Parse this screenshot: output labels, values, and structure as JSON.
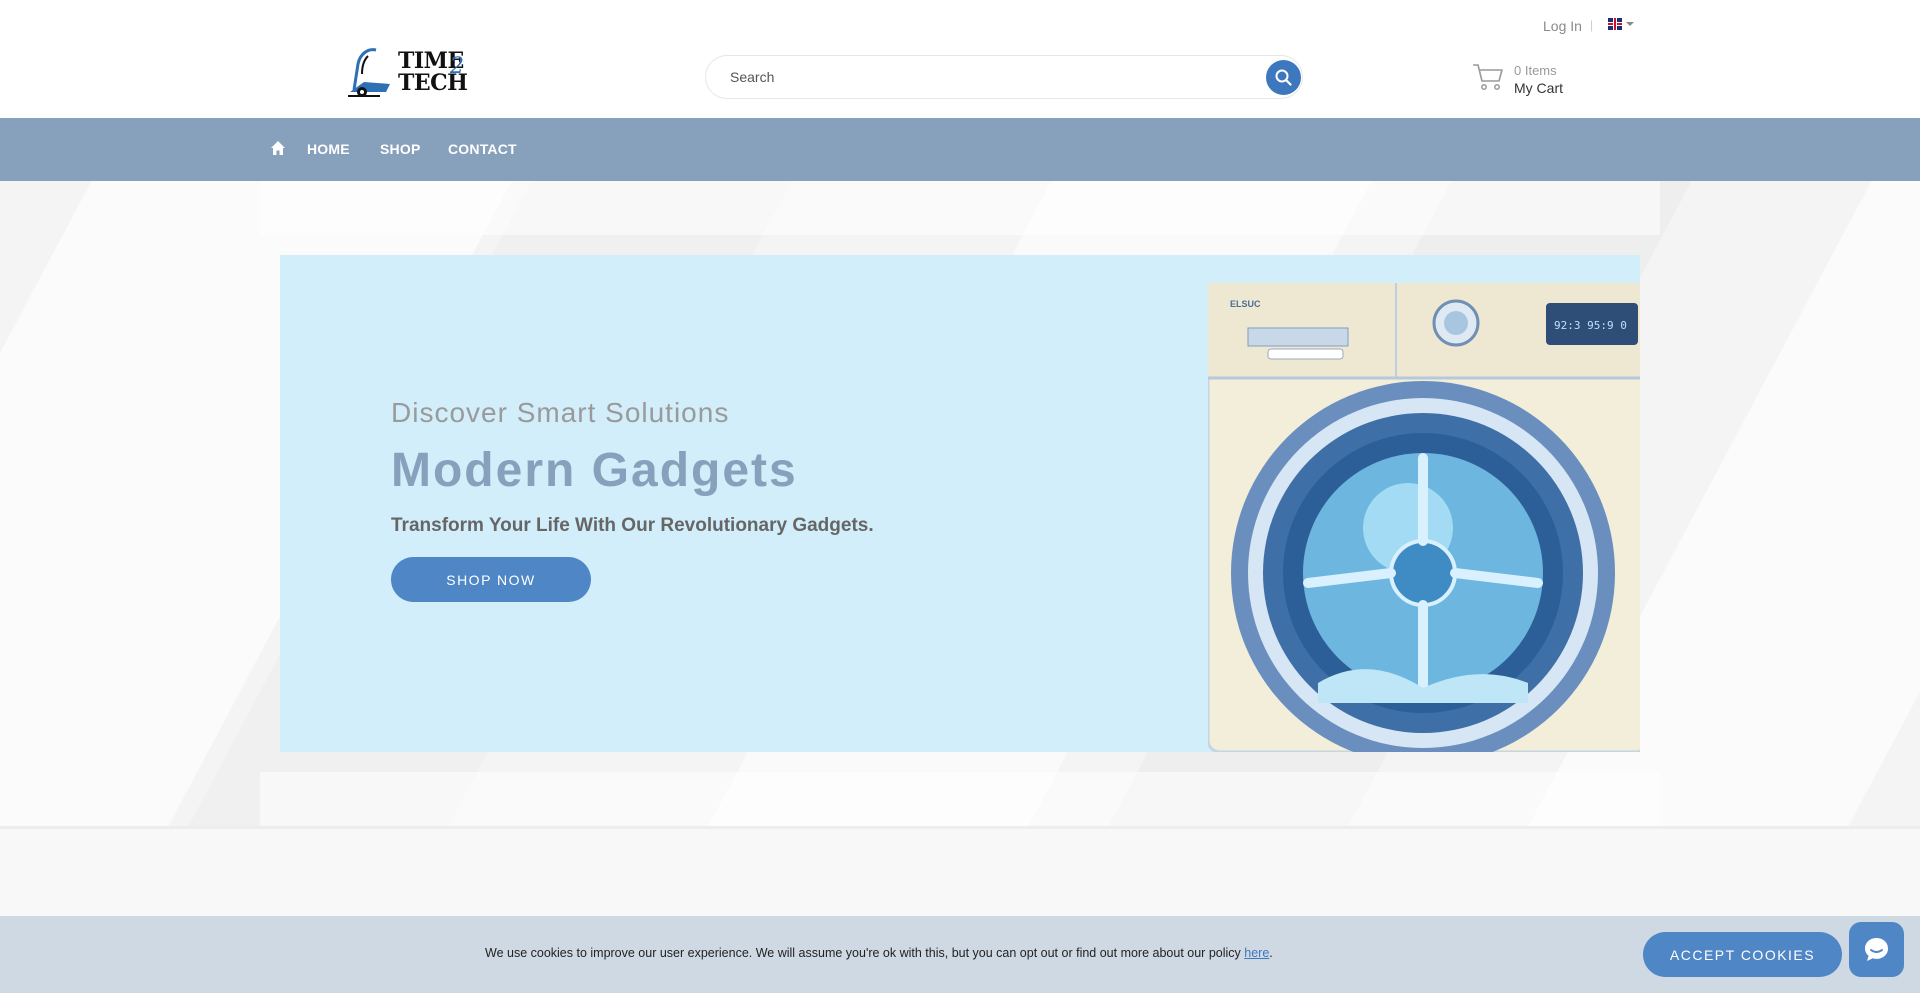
{
  "header": {
    "login_label": "Log In",
    "language": "English (UK)",
    "logo_line1": "TIME",
    "logo_line2": "TECH",
    "logo_mark": "2",
    "search_placeholder": "Search",
    "cart_count": "0 Items",
    "cart_label": "My Cart"
  },
  "nav": {
    "items": [
      "HOME",
      "SHOP",
      "CONTACT"
    ]
  },
  "hero": {
    "kicker": "Discover Smart Solutions",
    "title": "Modern Gadgets",
    "subtitle": "Transform Your Life With Our Revolutionary Gadgets.",
    "cta": "SHOP NOW",
    "image_label": "ELSUC",
    "display_readout": "92:3 95:9 0"
  },
  "cookie": {
    "text": "We use cookies to improve our user experience. We will assume you're ok with this, but you can opt out or find out more about our policy ",
    "link": "here",
    "end": ".",
    "accept": "ACCEPT COOKIES"
  },
  "icons": {
    "home": "home-icon",
    "search": "search-icon",
    "cart": "cart-icon",
    "chat": "chat-icon",
    "flag": "uk-flag-icon"
  },
  "colors": {
    "nav_bg": "#87a0bb",
    "accent": "#4e86c6",
    "hero_bg": "#d1eefa",
    "cookie_bg": "#cfd9e4"
  }
}
